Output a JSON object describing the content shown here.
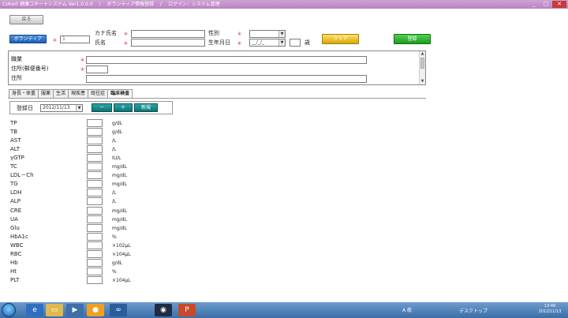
{
  "window": {
    "title": "Cohort 健康コホートシステム Ver1.0.0.0",
    "screen": "ボランティア情報登録",
    "login": "ログイン：システム管理"
  },
  "header": {
    "back_label": "戻る",
    "volunteer_label": "ボランティア",
    "id_value": "1",
    "kana_label": "カナ氏名",
    "name_label": "氏名",
    "gender_label": "性別",
    "birth_label": "生年月日",
    "birth_value": "__/_/_",
    "age_unit": "歳",
    "clear_label": "クリア",
    "register_label": "登録"
  },
  "address": {
    "occupation_label": "職業",
    "postal_label": "住所(郵便番号)",
    "address_label": "住所"
  },
  "tabs": [
    {
      "label": "身長・体重"
    },
    {
      "label": "服薬"
    },
    {
      "label": "生活"
    },
    {
      "label": "現疾患"
    },
    {
      "label": "既往症"
    },
    {
      "label": "臨床検査"
    }
  ],
  "lab": {
    "date_label": "登録日",
    "date_value": "2012/11/13",
    "minus_label": "－",
    "plus_label": "＋",
    "new_label": "新規",
    "rows": [
      {
        "name": "TP",
        "unit": "g/dL"
      },
      {
        "name": "TB",
        "unit": "g/dL"
      },
      {
        "name": "AST",
        "unit": "/L"
      },
      {
        "name": "ALT",
        "unit": "/L"
      },
      {
        "name": "γGTP",
        "unit": "IU/L"
      },
      {
        "name": "TC",
        "unit": "mg/dL"
      },
      {
        "name": "LDL－Ch",
        "unit": "mg/dL"
      },
      {
        "name": "TG",
        "unit": "mg/dL"
      },
      {
        "name": "LDH",
        "unit": "/L"
      },
      {
        "name": "ALP",
        "unit": "/L"
      },
      {
        "name": "CRE",
        "unit": "mg/dL"
      },
      {
        "name": "UA",
        "unit": "mg/dL"
      },
      {
        "name": "Glu",
        "unit": "mg/dL"
      },
      {
        "name": "HbA1c",
        "unit": "%"
      },
      {
        "name": "WBC",
        "unit": "×102μL"
      },
      {
        "name": "RBC",
        "unit": "×104μL"
      },
      {
        "name": "Hb",
        "unit": "g/dL"
      },
      {
        "name": "Ht",
        "unit": "%"
      },
      {
        "name": "PLT",
        "unit": "×104μL"
      }
    ]
  },
  "taskbar": {
    "desktop_label": "デスクトップ",
    "time": "13:49",
    "date": "2012/11/13",
    "ime": "A 般"
  },
  "colors": {
    "titlebar": "#b983c2",
    "volunteer_button": "#1b5fb5",
    "clear_button": "#d5a900",
    "register_button": "#1f9a1f",
    "teal_button": "#0f7474",
    "required_mark": "#d33a7a"
  }
}
